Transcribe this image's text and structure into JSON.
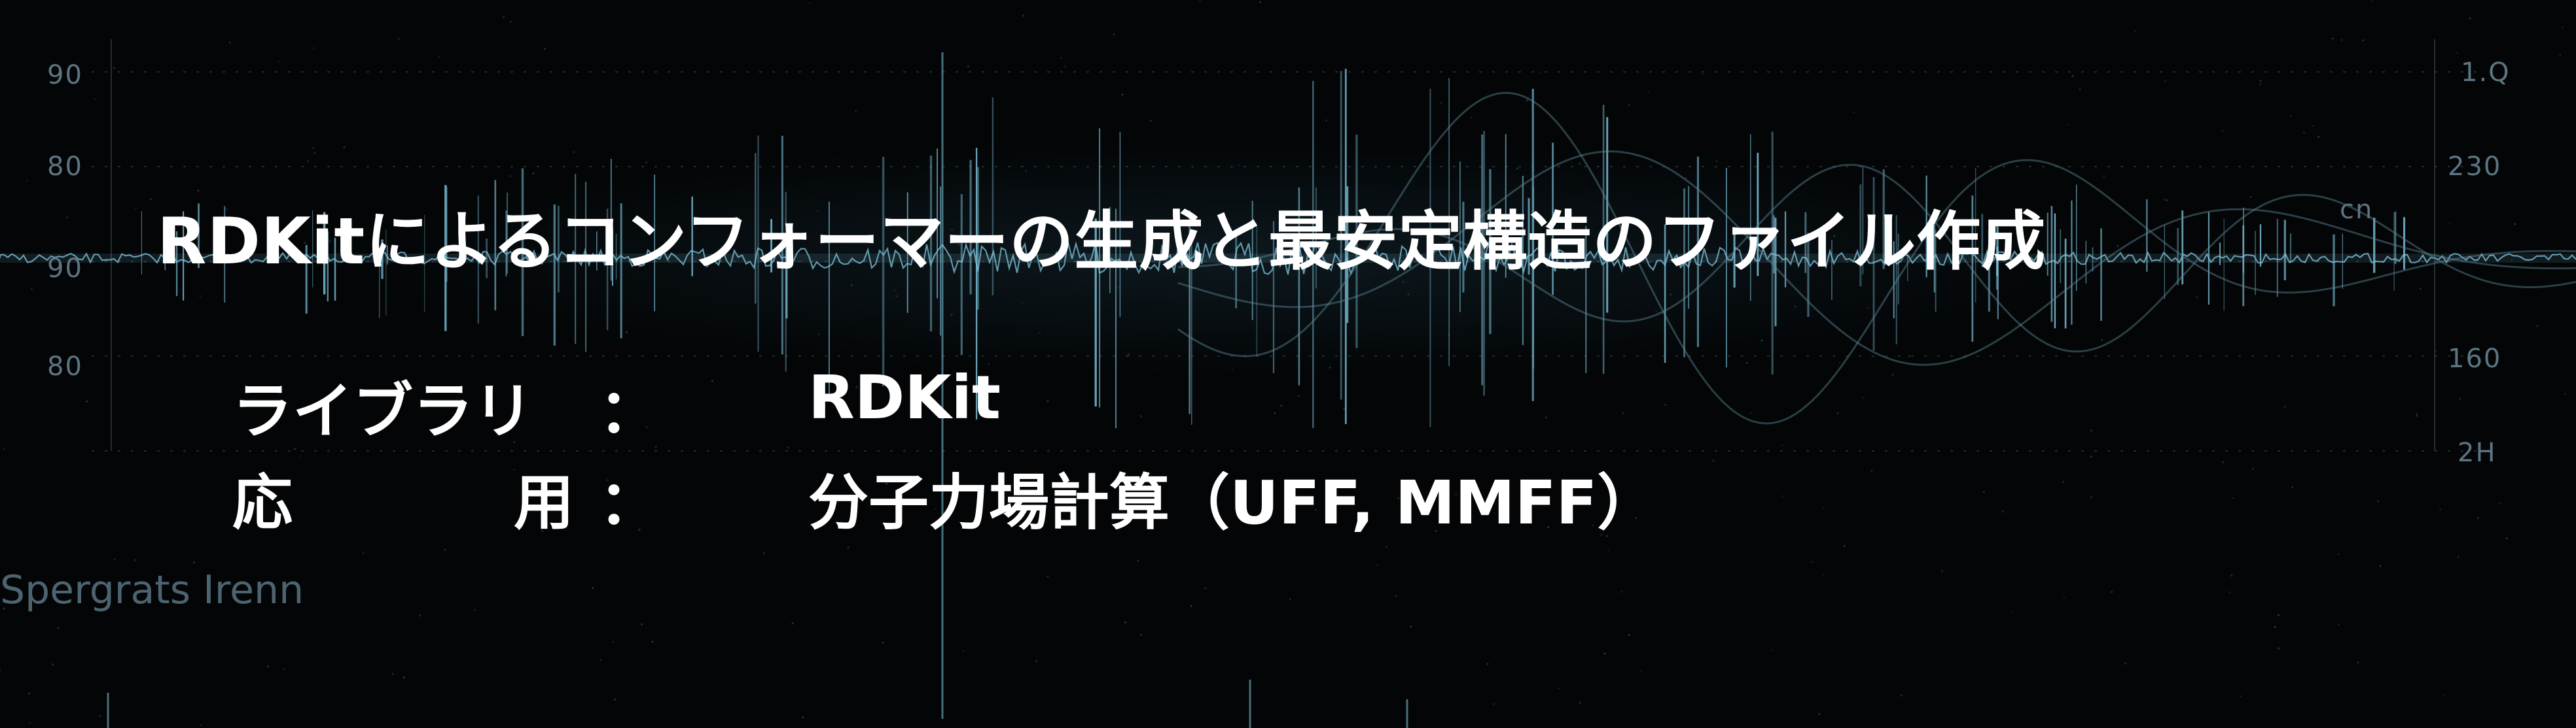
{
  "title": "RDKitによるコンフォーマーの生成と最安定構造のファイル作成",
  "rows": [
    {
      "label": "ライブラリ",
      "colon": "：",
      "value": "RDKit"
    },
    {
      "label_first": "応",
      "label_second": "用",
      "colon": "：",
      "value": "分子力場計算（UFF, MMFF）"
    }
  ],
  "background": {
    "left_axis_labels": [
      "90",
      "80",
      "90",
      "80"
    ],
    "right_axis_labels": [
      "1.Q",
      "230",
      "cn",
      "160",
      "2H"
    ],
    "overlay_text": "Spergrats Irenn",
    "colors": {
      "background": "#030506",
      "wave": "#7fc4dc",
      "text": "#ffffff"
    }
  }
}
